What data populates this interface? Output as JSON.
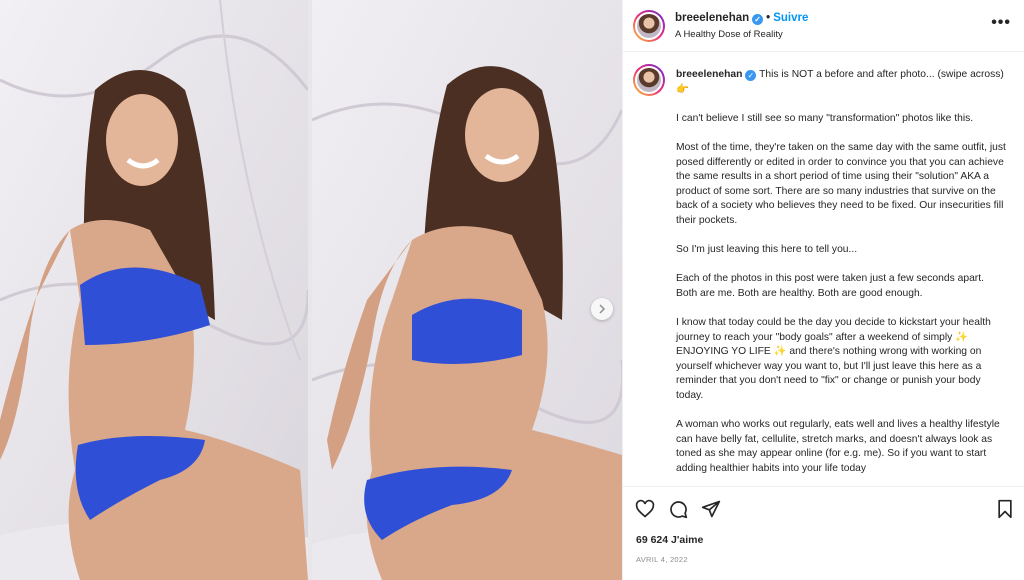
{
  "post": {
    "username": "breeelenehan",
    "follow_label": "Suivre",
    "subtitle": "A Healthy Dose of Reality",
    "caption_intro": "This is NOT a before and after photo... (swipe across) 👉",
    "caption_paragraphs": [
      "I can't believe I still see so many \"transformation\" photos like this.",
      "Most of the time, they're taken on the same day with the same outfit, just posed differently or edited in order to convince you that you can achieve the same results in a short period of time using their \"solution\" AKA a product of some sort. There are so many industries that survive on the back of a society who believes they need to be fixed. Our insecurities fill their pockets.",
      "So I'm just leaving this here to tell you...",
      "Each of the photos in this post were taken just a few seconds apart. Both are me. Both are healthy. Both are good enough.",
      "I know that today could be the day you decide to kickstart your health journey to reach your \"body goals\" after a weekend of simply ✨ ENJOYING YO LIFE ✨ and there's nothing wrong with working on yourself whichever way you want to, but I'll just leave this here as a reminder that you don't need to \"fix\" or change or punish your body today.",
      "A woman who works out regularly, eats well and lives a healthy lifestyle can have belly fat, cellulite, stretch marks, and doesn't always look as toned as she may appear online (for e.g. me). So if you want to start adding healthier habits into your life today"
    ],
    "likes": "69 624 J'aime",
    "date": "AVRIL 4, 2022"
  },
  "icons": {
    "verified": "verified-badge-icon",
    "more": "more-options-icon",
    "like": "heart-icon",
    "comment": "comment-icon",
    "share": "paper-plane-icon",
    "save": "bookmark-icon",
    "next": "chevron-right-icon"
  },
  "colors": {
    "accent": "#0095f6",
    "verified": "#3897f0",
    "bikini": "#2f4fd6",
    "backdrop": "#e9e6ea"
  }
}
